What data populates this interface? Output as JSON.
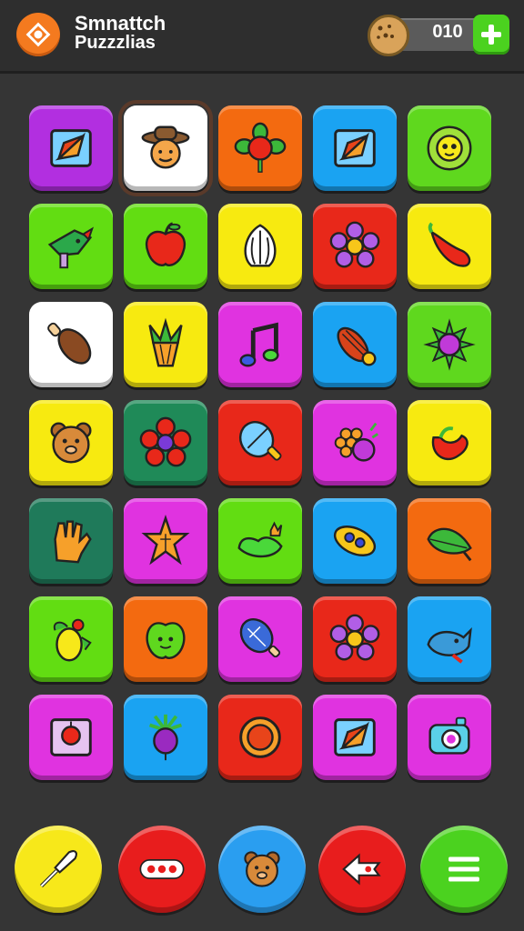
{
  "header": {
    "title_line1": "Smnattch",
    "title_line2": "Puzzzlias",
    "score": "010",
    "logo_icon": "puzzle-logo-icon",
    "coin_icon": "cookie-coin-icon",
    "add_icon": "plus-icon"
  },
  "colors": {
    "purple": "#b22fe0",
    "orange": "#f36a10",
    "blue": "#1aa3f2",
    "green": "#5fd81e",
    "lime": "#62dd12",
    "red": "#e8281a",
    "yellow": "#f7ea10",
    "white": "#ffffff",
    "magenta": "#e033e0",
    "darkgreen": "#1f8a58",
    "teal": "#1f7a5a"
  },
  "board": {
    "rows": 7,
    "cols": 5,
    "tiles": [
      {
        "color": "purple",
        "icon": "compass-card-icon"
      },
      {
        "color": "white",
        "icon": "cowboy-face-icon",
        "selected": true
      },
      {
        "color": "orange",
        "icon": "berry-flower-icon"
      },
      {
        "color": "blue",
        "icon": "compass-card-icon"
      },
      {
        "color": "green",
        "icon": "sunflower-face-icon"
      },
      {
        "color": "lime",
        "icon": "green-bird-icon"
      },
      {
        "color": "lime",
        "icon": "apple-icon"
      },
      {
        "color": "yellow",
        "icon": "garlic-icon"
      },
      {
        "color": "red",
        "icon": "purple-flower-icon"
      },
      {
        "color": "yellow",
        "icon": "chili-pepper-icon"
      },
      {
        "color": "white",
        "icon": "drumstick-icon"
      },
      {
        "color": "yellow",
        "icon": "pineapple-top-icon"
      },
      {
        "color": "magenta",
        "icon": "music-note-icon"
      },
      {
        "color": "blue",
        "icon": "onion-icon"
      },
      {
        "color": "green",
        "icon": "spiky-ball-icon"
      },
      {
        "color": "yellow",
        "icon": "bear-face-icon"
      },
      {
        "color": "darkgreen",
        "icon": "red-flower-icon"
      },
      {
        "color": "red",
        "icon": "leaf-paddle-icon"
      },
      {
        "color": "magenta",
        "icon": "grapes-icon"
      },
      {
        "color": "yellow",
        "icon": "red-pepper-icon"
      },
      {
        "color": "teal",
        "icon": "glove-icon"
      },
      {
        "color": "magenta",
        "icon": "star-flower-icon"
      },
      {
        "color": "lime",
        "icon": "leaf-crown-icon"
      },
      {
        "color": "blue",
        "icon": "yellow-pod-icon"
      },
      {
        "color": "orange",
        "icon": "green-leaf-icon"
      },
      {
        "color": "lime",
        "icon": "lemon-icon"
      },
      {
        "color": "orange",
        "icon": "green-apple-face-icon"
      },
      {
        "color": "magenta",
        "icon": "bulb-icon"
      },
      {
        "color": "red",
        "icon": "purple-flower-icon"
      },
      {
        "color": "blue",
        "icon": "blue-bird-icon"
      },
      {
        "color": "magenta",
        "icon": "red-button-card-icon"
      },
      {
        "color": "blue",
        "icon": "radish-icon"
      },
      {
        "color": "red",
        "icon": "orange-button-icon"
      },
      {
        "color": "magenta",
        "icon": "compass-card-icon"
      },
      {
        "color": "magenta",
        "icon": "camera-icon"
      }
    ]
  },
  "bottom_bar": [
    {
      "color": "#f7e81a",
      "icon": "trowel-icon"
    },
    {
      "color": "#e81d1d",
      "icon": "more-dots-icon"
    },
    {
      "color": "#2a9ef0",
      "icon": "bear-face-icon"
    },
    {
      "color": "#e81d1d",
      "icon": "hand-arrow-icon"
    },
    {
      "color": "#4bd21f",
      "icon": "menu-lines-icon"
    }
  ]
}
